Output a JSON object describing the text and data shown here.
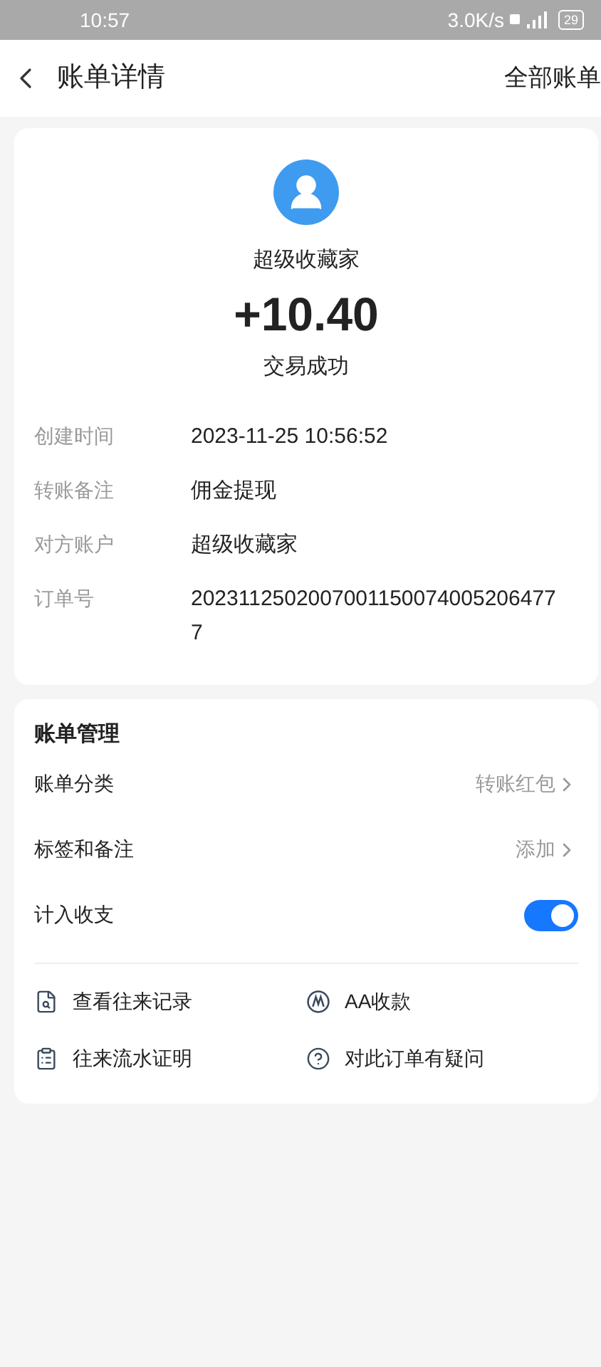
{
  "status_bar": {
    "time": "10:57",
    "speed": "3.0K/s",
    "battery": "29"
  },
  "nav": {
    "title": "账单详情",
    "action": "全部账单"
  },
  "summary": {
    "name": "超级收藏家",
    "amount": "+10.40",
    "status": "交易成功"
  },
  "details": [
    {
      "label": "创建时间",
      "value": "2023-11-25 10:56:52"
    },
    {
      "label": "转账备注",
      "value": "佣金提现"
    },
    {
      "label": "对方账户",
      "value": "超级收藏家"
    },
    {
      "label": "订单号",
      "value": "20231125020070011500740052064777"
    }
  ],
  "management": {
    "title": "账单管理",
    "rows": [
      {
        "kind": "link",
        "label": "账单分类",
        "value": "转账红包"
      },
      {
        "kind": "link",
        "label": "标签和备注",
        "value": "添加"
      },
      {
        "kind": "toggle",
        "label": "计入收支",
        "on": true
      }
    ],
    "actions": [
      {
        "kind": "record",
        "label": "查看往来记录"
      },
      {
        "kind": "aa",
        "label": "AA收款"
      },
      {
        "kind": "proof",
        "label": "往来流水证明"
      },
      {
        "kind": "question",
        "label": "对此订单有疑问"
      }
    ]
  }
}
